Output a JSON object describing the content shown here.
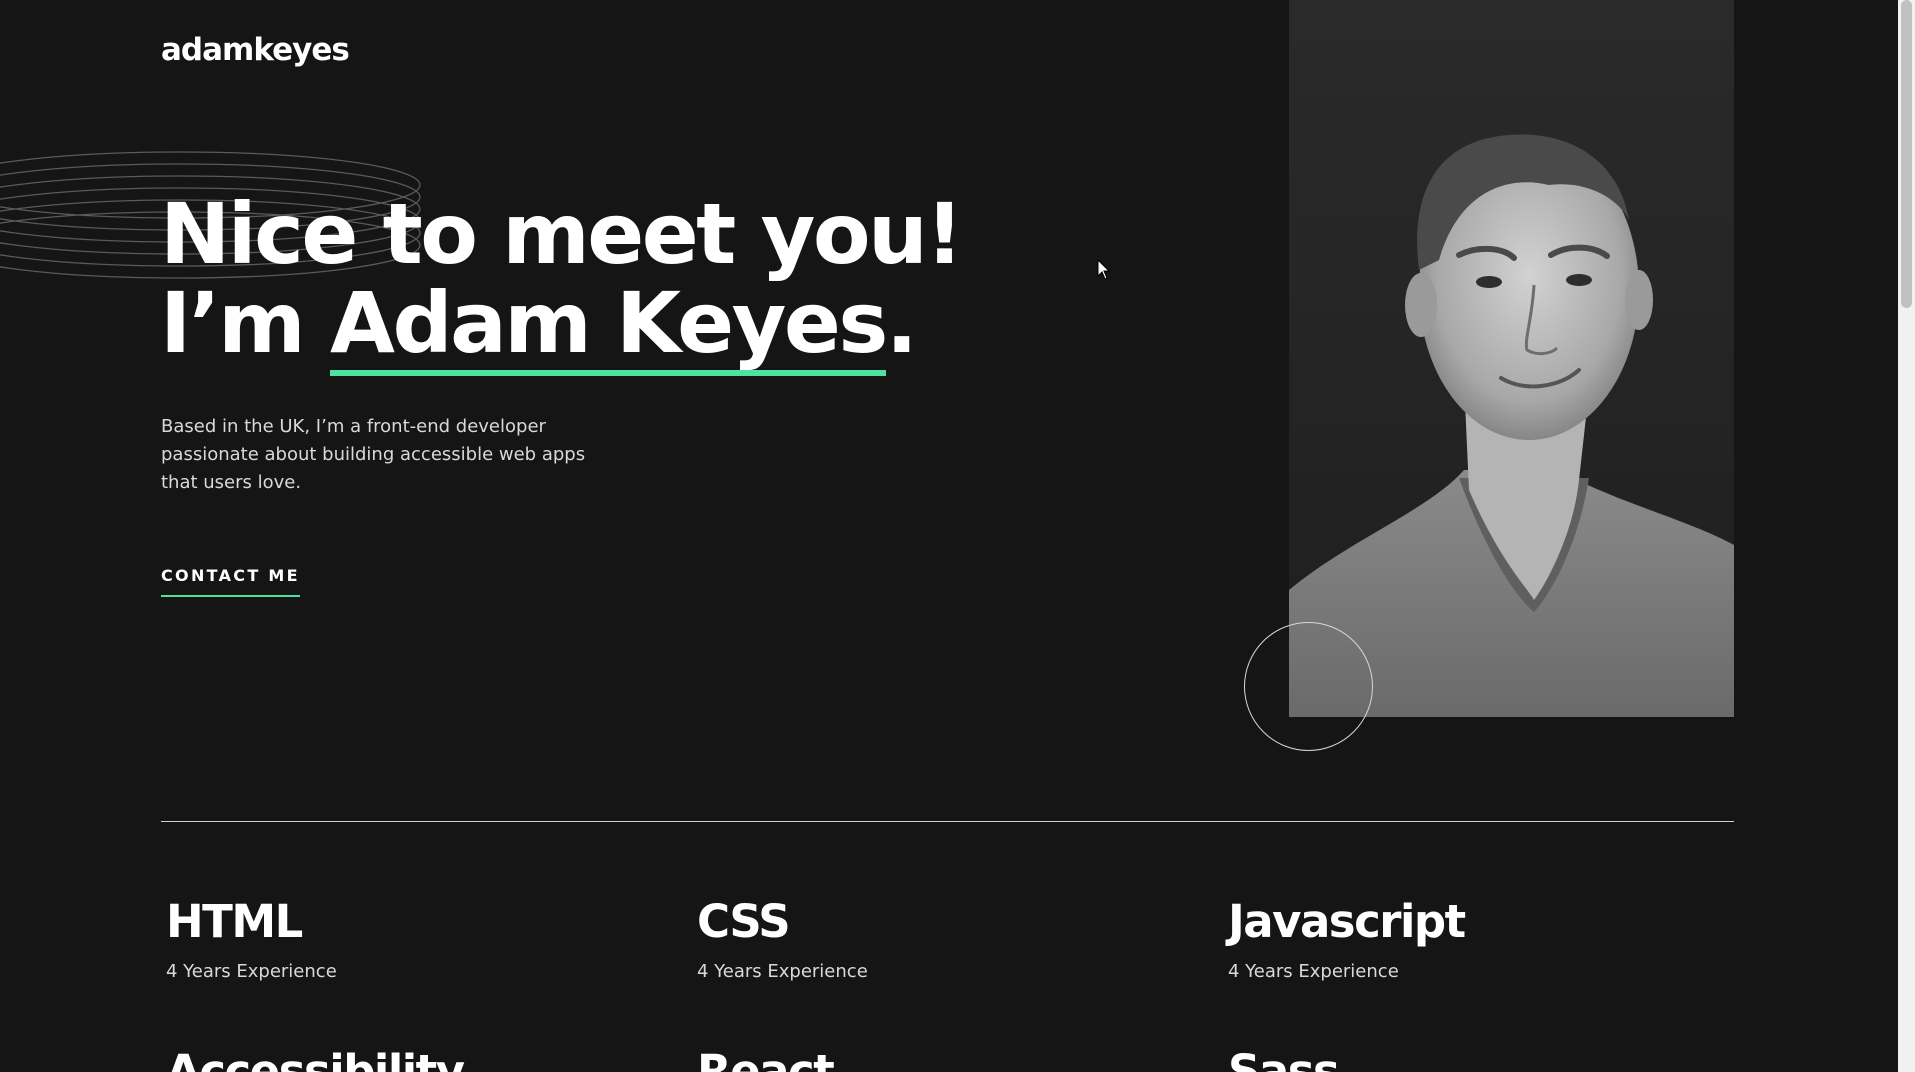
{
  "header": {
    "logo": "adamkeyes",
    "socials": [
      {
        "icon": "github-icon"
      },
      {
        "icon": "frontend-mentor-icon"
      },
      {
        "icon": "linkedin-icon"
      },
      {
        "icon": "twitter-icon"
      }
    ]
  },
  "hero": {
    "title_line1": "Nice to meet you!",
    "title_prefix": "I’m ",
    "title_name": "Adam Keyes",
    "title_suffix": ".",
    "description": "Based in the UK, I’m a front-end developer passionate about building accessible web apps that users love.",
    "contact_label": "CONTACT ME"
  },
  "skills": [
    {
      "name": "HTML",
      "experience": "4 Years Experience"
    },
    {
      "name": "CSS",
      "experience": "4 Years Experience"
    },
    {
      "name": "Javascript",
      "experience": "4 Years Experience"
    },
    {
      "name": "Accessibility",
      "experience": ""
    },
    {
      "name": "React",
      "experience": ""
    },
    {
      "name": "Sass",
      "experience": ""
    }
  ],
  "colors": {
    "background": "#151515",
    "accent": "#4ee1a0",
    "text": "#ffffff",
    "muted_text": "#d9d9d9"
  }
}
